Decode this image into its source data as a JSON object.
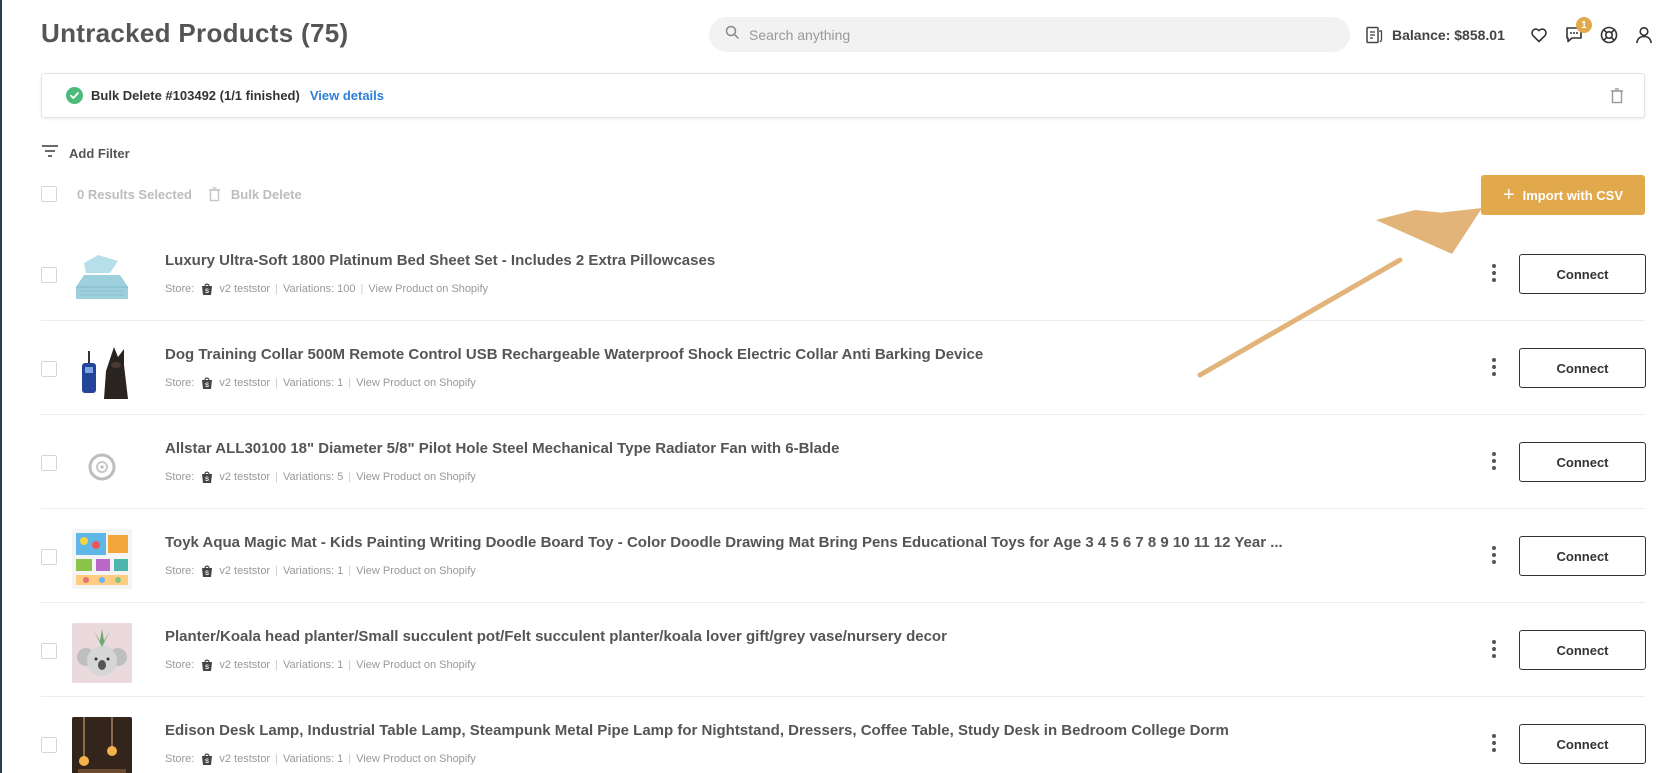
{
  "page": {
    "title": "Untracked Products (75)"
  },
  "search": {
    "placeholder": "Search anything"
  },
  "header": {
    "balance": "Balance: $858.01",
    "messages_badge": "1",
    "icons": [
      "balance-icon",
      "heart-icon",
      "chat-icon",
      "support-icon",
      "user-icon"
    ]
  },
  "notice": {
    "text": "Bulk Delete #103492 (1/1 finished)",
    "link": "View details",
    "status_color": "#4cbb7a"
  },
  "filters": {
    "add_filter": "Add Filter",
    "selected": "0 Results Selected",
    "bulk_delete": "Bulk Delete"
  },
  "import_button": {
    "label": "Import with CSV",
    "color": "#e2a84c"
  },
  "products": [
    {
      "title": "Luxury Ultra-Soft 1800 Platinum Bed Sheet Set - Includes 2 Extra Pillowcases",
      "store_label": "Store:",
      "store": "v2 teststor",
      "variations": "Variations: 100",
      "view": "View Product on Shopify",
      "connect": "Connect",
      "thumb": "bed-sheet-image"
    },
    {
      "title": "Dog Training Collar 500M Remote Control USB Rechargeable Waterproof Shock Electric Collar Anti Barking Device",
      "store_label": "Store:",
      "store": "v2 teststor",
      "variations": "Variations: 1",
      "view": "View Product on Shopify",
      "connect": "Connect",
      "thumb": "dog-collar-image"
    },
    {
      "title": "Allstar ALL30100 18\" Diameter 5/8\" Pilot Hole Steel Mechanical Type Radiator Fan with 6-Blade",
      "store_label": "Store:",
      "store": "v2 teststor",
      "variations": "Variations: 5",
      "view": "View Product on Shopify",
      "connect": "Connect",
      "thumb": "radiator-fan-image"
    },
    {
      "title": "Toyk Aqua Magic Mat - Kids Painting Writing Doodle Board Toy - Color Doodle Drawing Mat Bring Pens Educational Toys for Age 3 4 5 6 7 8 9 10 11 12 Year ...",
      "store_label": "Store:",
      "store": "v2 teststor",
      "variations": "Variations: 1",
      "view": "View Product on Shopify",
      "connect": "Connect",
      "thumb": "doodle-mat-image"
    },
    {
      "title": "Planter/Koala head planter/Small succulent pot/Felt succulent planter/koala lover gift/grey vase/nursery decor",
      "store_label": "Store:",
      "store": "v2 teststor",
      "variations": "Variations: 1",
      "view": "View Product on Shopify",
      "connect": "Connect",
      "thumb": "koala-planter-image"
    },
    {
      "title": "Edison Desk Lamp, Industrial Table Lamp, Steampunk Metal Pipe Lamp for Nightstand, Dressers, Coffee Table, Study Desk in Bedroom College Dorm",
      "store_label": "Store:",
      "store": "v2 teststor",
      "variations": "Variations: 1",
      "view": "View Product on Shopify",
      "connect": "Connect",
      "thumb": "desk-lamp-image"
    }
  ]
}
